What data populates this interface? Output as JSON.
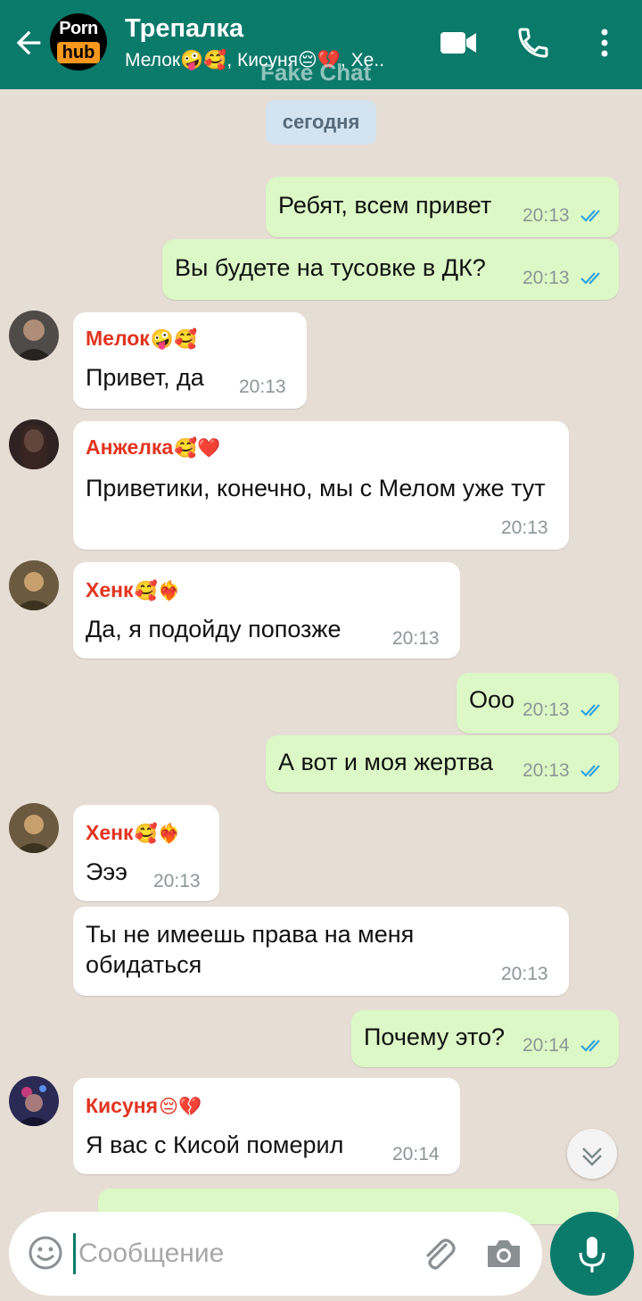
{
  "header": {
    "title": "Трепалка",
    "members": "Мелок🤪🥰, Кисуня😔💔, Хе..",
    "watermark": "Fake Chat",
    "logo_top": "Porn",
    "logo_bottom": "hub"
  },
  "date_chip": "сегодня",
  "messages": [
    {
      "text": "Ребят, всем привет",
      "time": "20:13"
    },
    {
      "text": "Вы будете на тусовке в ДК?",
      "time": "20:13"
    },
    {
      "sender": "Мелок",
      "emoji": "🤪🥰",
      "text": "Привет, да",
      "time": "20:13"
    },
    {
      "sender": "Анжелка",
      "emoji": "🥰❤️",
      "text": "Приветики, конечно, мы с Мелом уже тут",
      "time": "20:13"
    },
    {
      "sender": "Хенк",
      "emoji": "🥰❤️‍🔥",
      "text": "Да, я подойду попозже",
      "time": "20:13"
    },
    {
      "text": "Ооо",
      "time": "20:13"
    },
    {
      "text": "А вот и моя жертва",
      "time": "20:13"
    },
    {
      "sender": "Хенк",
      "emoji": "🥰❤️‍🔥",
      "text": "Эээ",
      "time": "20:13"
    },
    {
      "text": "Ты не имеешь права на меня обидаться",
      "time": "20:13"
    },
    {
      "text": "Почему это?",
      "time": "20:14"
    },
    {
      "sender": "Кисуня",
      "emoji": "😔💔",
      "text": "Я вас с Кисой померил",
      "time": "20:14"
    }
  ],
  "input": {
    "placeholder": "Сообщение"
  },
  "colors": {
    "header": "#0a7a6b",
    "outgoing_bubble": "#dcf8c6",
    "incoming_bubble": "#ffffff",
    "sender_name": "#e2341f",
    "read_ticks": "#34a3e0",
    "chat_background": "#e6ddd4"
  },
  "icons": [
    "back-arrow-icon",
    "video-call-icon",
    "phone-icon",
    "more-vert-icon",
    "emoji-icon",
    "attach-icon",
    "camera-icon",
    "mic-icon",
    "chevron-down-icon",
    "double-check-icon"
  ]
}
